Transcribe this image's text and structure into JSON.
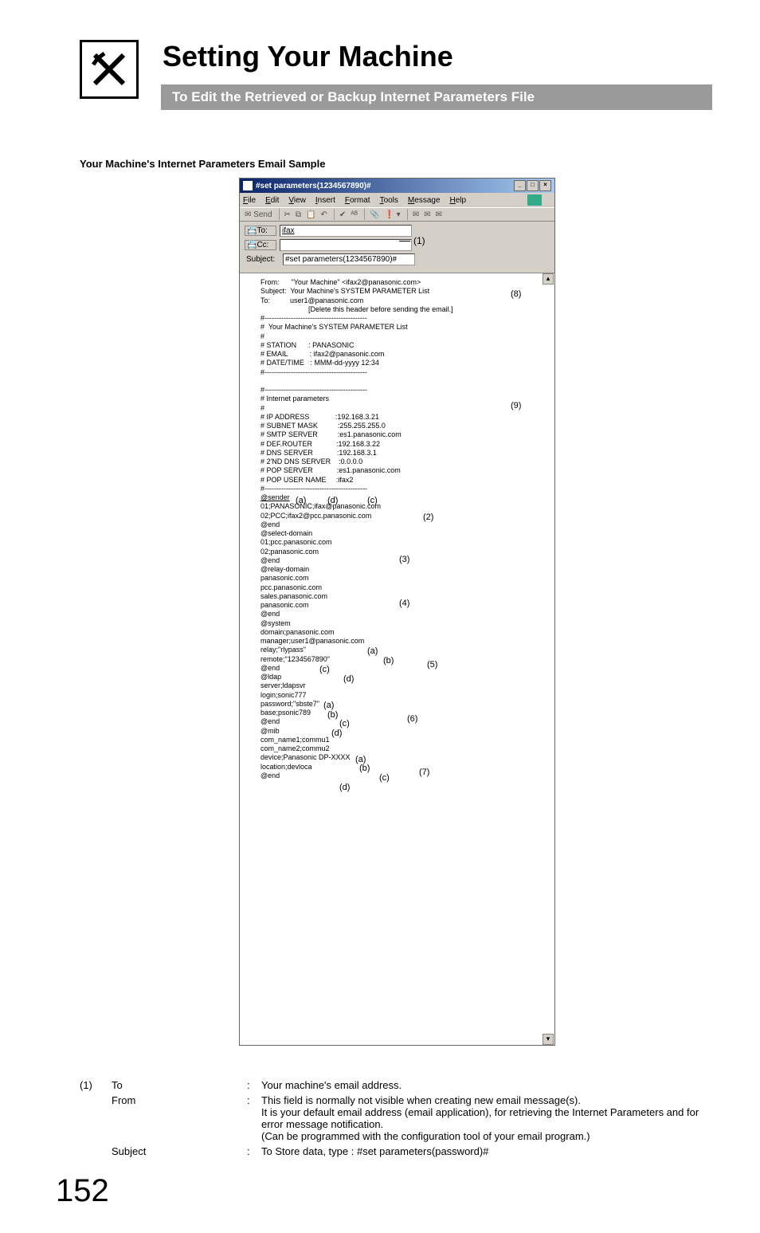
{
  "header": {
    "title": "Setting Your Machine",
    "subtitle": "To Edit the Retrieved or Backup Internet Parameters File"
  },
  "section_label": "Your Machine's Internet Parameters Email Sample",
  "email_window": {
    "title": "#set parameters(1234567890)#",
    "menu": {
      "file": "File",
      "edit": "Edit",
      "view": "View",
      "insert": "Insert",
      "format": "Format",
      "tools": "Tools",
      "message": "Message",
      "help": "Help"
    },
    "send_btn": "Send",
    "to_label": "To:",
    "cc_label": "Cc:",
    "subj_label": "Subject:",
    "to_value": "ifax",
    "cc_value": "",
    "subj_value": "#set parameters(1234567890)#",
    "callout_1": "(1)",
    "body_lines": {
      "l01": "From:      \"Your Machine\" <ifax2@panasonic.com>",
      "l02": "Subject:  Your Machine's SYSTEM PARAMETER List",
      "l03": "To:          user1@panasonic.com",
      "l04": "                        [Delete this header before sending the email.]",
      "l05": "#-------------------------------------------",
      "l06": "#  Your Machine's SYSTEM PARAMETER List",
      "l07": "#",
      "l08": "# STATION      : PANASONIC",
      "l09": "# EMAIL           : ifax2@panasonic.com",
      "l10": "# DATE/TIME   : MMM-dd-yyyy 12:34",
      "l11": "#-------------------------------------------",
      "l12": "",
      "l13": "#-------------------------------------------",
      "l14": "# Internet parameters",
      "l15": "#",
      "l16": "# IP ADDRESS             :192.168.3.21",
      "l17": "# SUBNET MASK          :255.255.255.0",
      "l18": "# SMTP SERVER          :es1.panasonic.com",
      "l19": "# DEF.ROUTER            :192.168.3.22",
      "l20": "# DNS SERVER            :192.168.3.1",
      "l21": "# 2'ND DNS SERVER    :0.0.0.0",
      "l22": "# POP SERVER            :es1.panasonic.com",
      "l23": "# POP USER NAME     :ifax2",
      "l24": "#-------------------------------------------",
      "l25": "@sender",
      "l26": "01;PANASONIC;ifax@panasonic.com",
      "l27": "02;PCC;ifax2@pcc.panasonic.com",
      "l28": "@end",
      "l29": "@select-domain",
      "l30": "01;pcc.panasonic.com",
      "l31": "02;panasonic.com",
      "l32": "@end",
      "l33": "@relay-domain",
      "l34": "panasonic.com",
      "l35": "pcc.panasonic.com",
      "l36": "sales.panasonic.com",
      "l37": "panasonic.com",
      "l38": "@end",
      "l39": "@system",
      "l40": "domain;panasonic.com",
      "l41": "manager;user1@panasonic.com",
      "l42": "relay;\"rlypass\"",
      "l43": "remote;\"1234567890\"",
      "l44": "@end",
      "l45": "@ldap",
      "l46": "server;ldapsvr",
      "l47": "login;sonic777",
      "l48": "password;\"sbste7\"",
      "l49": "base;psonic789",
      "l50": "@end",
      "l51": "@mib",
      "l52": "com_name1;commu1",
      "l53": "com_name2;commu2",
      "l54": "device;Panasonic DP-XXXX",
      "l55": "location;devloca",
      "l56": "@end"
    },
    "annotations": {
      "a8": "(8)",
      "a9": "(9)",
      "a_a": "(a)",
      "a_d": "(d)",
      "a_c": "(c)",
      "a2": "(2)",
      "a3": "(3)",
      "a4": "(4)",
      "a5": "(5)",
      "a6": "(6)",
      "a7": "(7)",
      "sys_a": "(a)",
      "sys_b": "(b)",
      "sys_c": "(c)",
      "sys_d": "(d)",
      "ldap_a": "(a)",
      "ldap_b": "(b)",
      "ldap_c": "(c)",
      "ldap_d": "(d)",
      "mib_a": "(a)",
      "mib_b": "(b)",
      "mib_c": "(c)",
      "mib_d": "(d)"
    }
  },
  "desc": {
    "row1_num": "(1)",
    "to_label": "To",
    "to_text": "Your machine's email address.",
    "from_label": "From",
    "from_text": "This field is normally not visible when creating new email message(s).\nIt is your default email address (email application), for retrieving the Internet Parameters and for error message notification.\n(Can be programmed with the configuration tool of your email program.)",
    "subject_label": "Subject",
    "subject_text": "To Store data, type :  #set parameters(password)#",
    "colon": ":"
  },
  "page_number": "152"
}
